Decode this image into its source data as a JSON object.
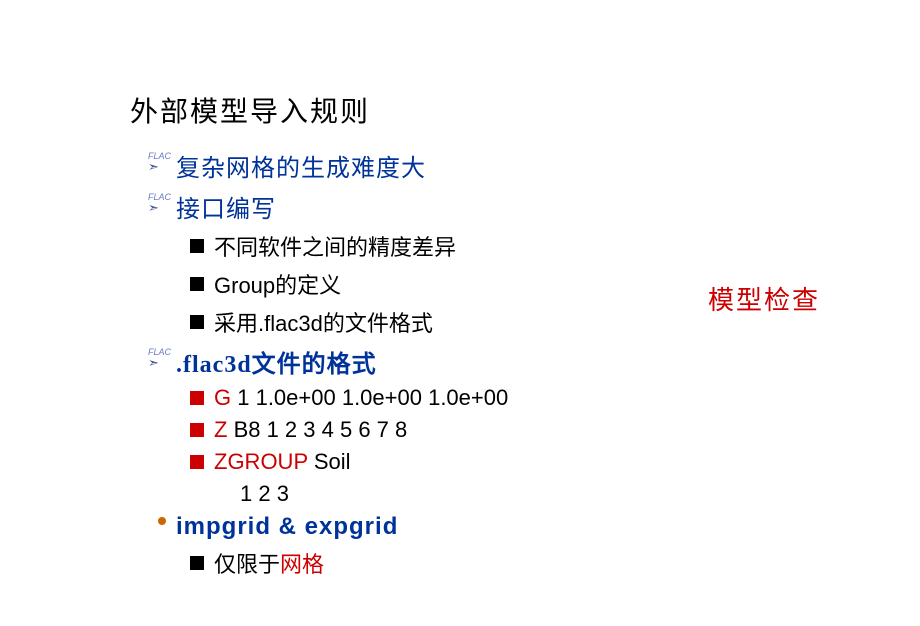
{
  "title": "外部模型导入规则",
  "sidebar_note": "模型检查",
  "items": {
    "l1_0": "复杂网格的生成难度大",
    "l1_1": "接口编写",
    "l2_0": "不同软件之间的精度差异",
    "l2_1": "Group的定义",
    "l2_2": "采用.flac3d的文件格式",
    "l1_2": ".flac3d文件的格式",
    "l2_3_prefix": "G",
    "l2_3_rest": " 1 1.0e+00 1.0e+00 1.0e+00",
    "l2_4_prefix": "Z",
    "l2_4_rest": " B8 1 2 3 4 5 6 7 8",
    "l2_5_prefix": "ZGROUP",
    "l2_5_rest": " Soil",
    "l3_0": "1 2 3",
    "l1_3": "impgrid & expgrid",
    "l2_6_prefix": "仅限于",
    "l2_6_suffix": "网格"
  },
  "flac_label": "FLAC",
  "flac_arrow": "➣"
}
